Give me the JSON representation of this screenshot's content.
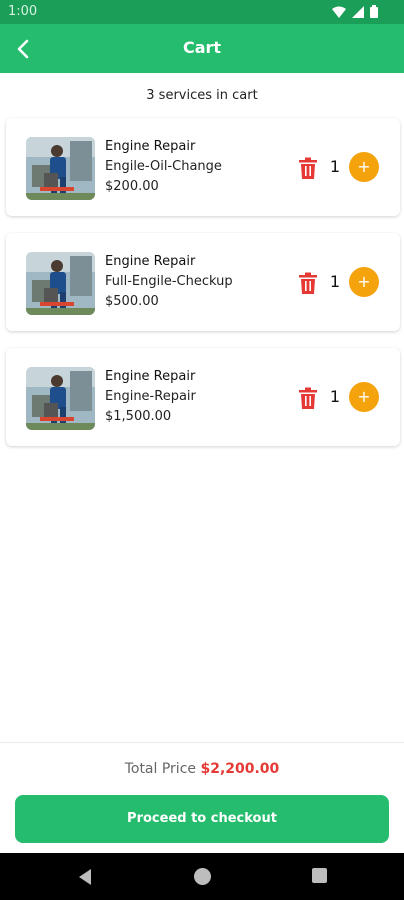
{
  "status_bar": {
    "time": "1:00"
  },
  "header": {
    "title": "Cart"
  },
  "summary": "3 services in cart",
  "items": [
    {
      "name": "Engine Repair",
      "service": "Engile-Oil-Change",
      "price": "$200.00",
      "qty": "1"
    },
    {
      "name": "Engine Repair",
      "service": "Full-Engile-Checkup",
      "price": "$500.00",
      "qty": "1"
    },
    {
      "name": "Engine Repair",
      "service": "Engine-Repair",
      "price": "$1,500.00",
      "qty": "1"
    }
  ],
  "footer": {
    "total_label": "Total Price",
    "total_value": "$2,200.00",
    "checkout_label": "Proceed to checkout"
  },
  "colors": {
    "primary": "#25bd6d",
    "accent": "#f5a30c",
    "delete": "#e53935"
  },
  "icons": {
    "back": "back-arrow-icon",
    "delete": "trash-icon",
    "add": "plus-icon"
  }
}
